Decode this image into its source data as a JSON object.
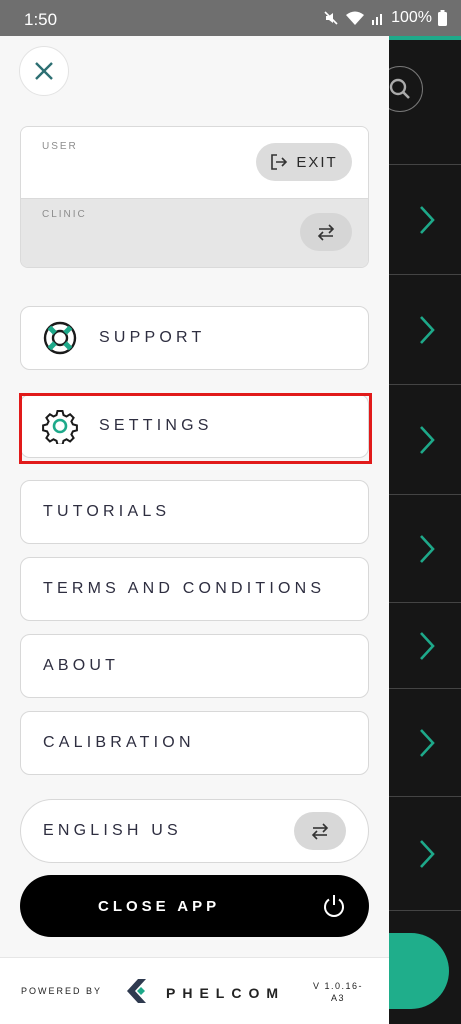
{
  "status": {
    "time": "1:50",
    "battery": "100%"
  },
  "user": {
    "label": "USER",
    "exit": "EXIT"
  },
  "clinic": {
    "label": "CLINIC"
  },
  "menu": {
    "support": "SUPPORT",
    "settings": "SETTINGS",
    "tutorials": "TUTORIALS",
    "terms": "TERMS AND CONDITIONS",
    "about": "ABOUT",
    "calibration": "CALIBRATION"
  },
  "language": {
    "label": "ENGLISH US"
  },
  "close_app": {
    "label": "CLOSE APP"
  },
  "footer": {
    "powered_by": "POWERED BY",
    "brand": "PHELCOM",
    "version": "V 1.0.16-A3"
  },
  "colors": {
    "accent": "#1ea98a",
    "highlight": "#e11a1a",
    "dark": "#000000"
  },
  "icons": [
    "close-icon",
    "exit-icon",
    "swap-icon",
    "lifebuoy-icon",
    "gear-icon",
    "power-icon",
    "search-icon",
    "chevron-right-icon",
    "mute-icon",
    "wifi-icon",
    "signal-icon",
    "battery-icon",
    "phelcom-logo-icon"
  ]
}
